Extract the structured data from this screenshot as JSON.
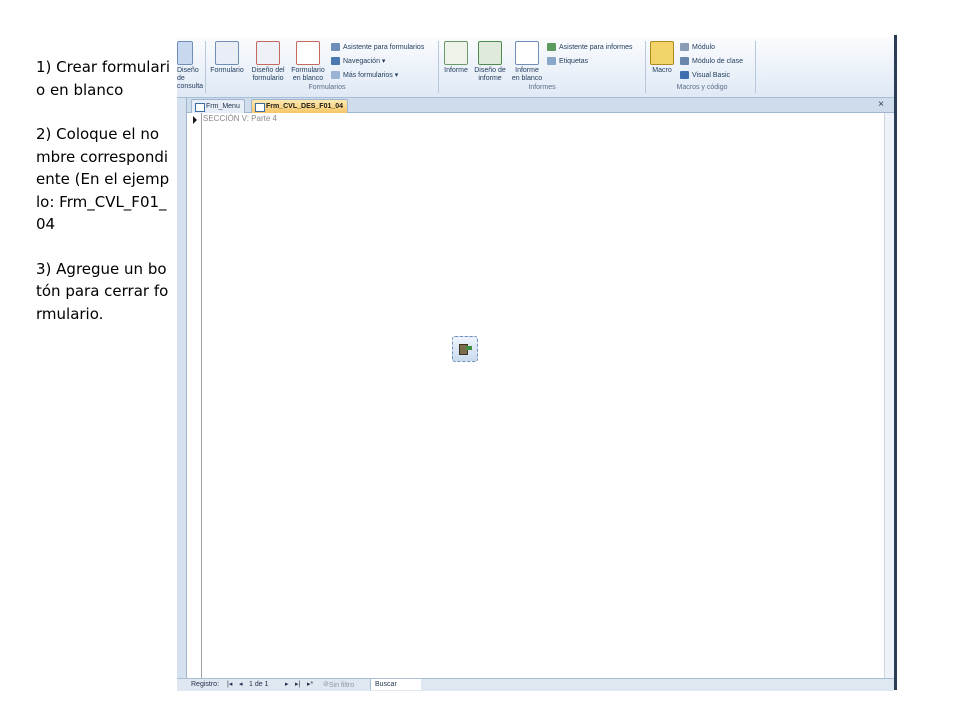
{
  "instructions": [
    "1) Crear formulario en blanco",
    "2) Coloque el nombre correspondiente (En el ejemplo: Frm_CVL_F01_04",
    "3) Agregue un botón para cerrar formulario."
  ],
  "ribbon": {
    "consultas_label": "Diseño de\nconsulta",
    "formularios": {
      "formulario": "Formulario",
      "diseno": "Diseño del\nformulario",
      "blanco": "Formulario\nen blanco",
      "asistente": "Asistente para formularios",
      "navegacion": "Navegación",
      "mas": "Más formularios",
      "group": "Formularios"
    },
    "informes": {
      "informe": "Informe",
      "diseno": "Diseño de\ninforme",
      "blanco": "Informe\nen blanco",
      "asistente": "Asistente para informes",
      "etiquetas": "Etiquetas",
      "group": "Informes"
    },
    "macros": {
      "macro": "Macro",
      "modulo": "Módulo",
      "modulo_clase": "Módulo de clase",
      "vb": "Visual Basic",
      "group": "Macros y código"
    }
  },
  "tabs": [
    {
      "label": "Frm_Menu",
      "active": false
    },
    {
      "label": "Frm_CVL_DES_F01_04",
      "active": true
    }
  ],
  "form": {
    "section_title": "SECCIÓN V: Parte  4"
  },
  "record_nav": {
    "label": "Registro:",
    "position": "1 de 1",
    "filter": "Sin filtro",
    "search": "Buscar"
  },
  "colors": {
    "active_tab": "#f7c668",
    "ribbon": "#dfe9f5",
    "frame": "#2b3d55"
  }
}
